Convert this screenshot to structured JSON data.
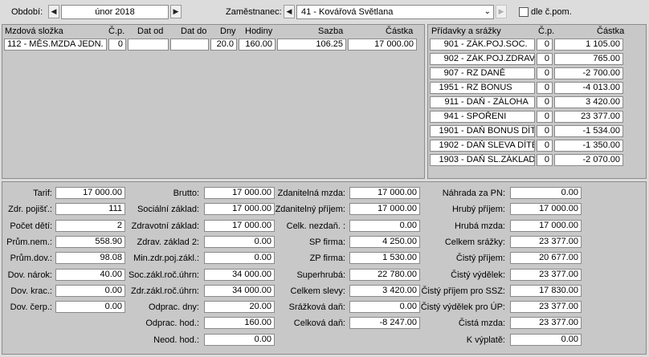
{
  "top": {
    "period_label": "Období:",
    "period_value": "únor 2018",
    "employee_label": "Zaměstnanec:",
    "employee_value": "41 - Kovářová Světlana",
    "per_employment_label": "dle č.pom."
  },
  "components": {
    "headers": {
      "name": "Mzdová složka",
      "cp": "Č.p.",
      "date_from": "Dat od",
      "date_to": "Dat do",
      "days": "Dny",
      "hours": "Hodiny",
      "rate": "Sazba",
      "amount": "Částka"
    },
    "rows": [
      {
        "name": "112 - MĚS.MZDA JEDN.",
        "cp": "0",
        "date_from": "",
        "date_to": "",
        "days": "20.0",
        "hours": "160.00",
        "rate": "106.25",
        "amount": "17 000.00"
      }
    ]
  },
  "deductions": {
    "headers": {
      "name": "Přídavky a srážky",
      "cp": "Č.p.",
      "amount": "Částka"
    },
    "rows": [
      {
        "code": "901",
        "name": "ZÁK.POJ.SOC.",
        "cp": "0",
        "amount": "1 105.00"
      },
      {
        "code": "902",
        "name": "ZÁK.POJ.ZDRAV.",
        "cp": "0",
        "amount": "765.00"
      },
      {
        "code": "907",
        "name": "RZ DANĚ",
        "cp": "0",
        "amount": "-2 700.00"
      },
      {
        "code": "1951",
        "name": "RZ BONUS",
        "cp": "0",
        "amount": "-4 013.00"
      },
      {
        "code": "911",
        "name": "DAŇ - ZÁLOHA",
        "cp": "0",
        "amount": "3 420.00"
      },
      {
        "code": "941",
        "name": "SPOŘENI",
        "cp": "0",
        "amount": "23 377.00"
      },
      {
        "code": "1901",
        "name": "DAŇ BONUS DÍTĚ",
        "cp": "0",
        "amount": "-1 534.00"
      },
      {
        "code": "1902",
        "name": "DAŇ SLEVA DÍTĚ",
        "cp": "0",
        "amount": "-1 350.00"
      },
      {
        "code": "1903",
        "name": "DAŇ SL.ZÁKLAD",
        "cp": "0",
        "amount": "-2 070.00"
      }
    ]
  },
  "summary": {
    "col1": [
      {
        "label": "Tarif:",
        "value": "17 000.00"
      },
      {
        "label": "Zdr. pojišť.:",
        "value": "111"
      },
      {
        "label": "Počet dětí:",
        "value": "2"
      },
      {
        "label": "Prům.nem.:",
        "value": "558.90"
      },
      {
        "label": "Prům.dov.:",
        "value": "98.08"
      },
      {
        "label": "Dov. nárok:",
        "value": "40.00"
      },
      {
        "label": "Dov. krac.:",
        "value": "0.00"
      },
      {
        "label": "Dov. čerp.:",
        "value": "0.00"
      }
    ],
    "col2": [
      {
        "label": "Brutto:",
        "value": "17 000.00"
      },
      {
        "label": "Sociální základ:",
        "value": "17 000.00"
      },
      {
        "label": "Zdravotní základ:",
        "value": "17 000.00"
      },
      {
        "label": "Zdrav. základ 2:",
        "value": "0.00"
      },
      {
        "label": "Min.zdr.poj.zákl.:",
        "value": "0.00"
      },
      {
        "label": "Soc.zákl.roč.úhrn:",
        "value": "34 000.00"
      },
      {
        "label": "Zdr.zákl.roč.úhrn:",
        "value": "34 000.00"
      },
      {
        "label": "Odprac. dny:",
        "value": "20.00"
      },
      {
        "label": "Odprac. hod.:",
        "value": "160.00"
      },
      {
        "label": "Neod. hod.:",
        "value": "0.00"
      }
    ],
    "col3": [
      {
        "label": "Zdanitelná mzda:",
        "value": "17 000.00"
      },
      {
        "label": "Zdanitelný příjem:",
        "value": "17 000.00"
      },
      {
        "label": "Celk. nezdaň. :",
        "value": "0.00"
      },
      {
        "label": "SP firma:",
        "value": "4 250.00"
      },
      {
        "label": "ZP firma:",
        "value": "1 530.00"
      },
      {
        "label": "Superhrubá:",
        "value": "22 780.00"
      },
      {
        "label": "Celkem slevy:",
        "value": "3 420.00"
      },
      {
        "label": "Srážková daň:",
        "value": "0.00"
      },
      {
        "label": "Celková daň:",
        "value": "-8 247.00"
      }
    ],
    "col4": [
      {
        "label": "Náhrada za PN:",
        "value": "0.00"
      },
      {
        "label": "Hrubý příjem:",
        "value": "17 000.00"
      },
      {
        "label": "Hrubá mzda:",
        "value": "17 000.00"
      },
      {
        "label": "Celkem srážky:",
        "value": "23 377.00"
      },
      {
        "label": "Čistý příjem:",
        "value": "20 677.00"
      },
      {
        "label": "Čistý výdělek:",
        "value": "23 377.00"
      },
      {
        "label": "Čistý příjem pro SSZ:",
        "value": "17 830.00"
      },
      {
        "label": "Čistý výdělek pro ÚP:",
        "value": "23 377.00"
      },
      {
        "label": "Čistá mzda:",
        "value": "23 377.00"
      },
      {
        "label": "K výplatě:",
        "value": "0.00"
      }
    ]
  }
}
